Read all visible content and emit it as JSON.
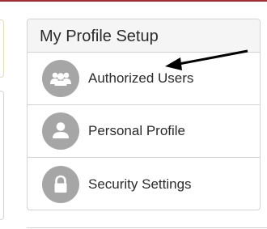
{
  "colors": {
    "top_rule": "#a32b38",
    "icon_circle": "#a6a6a6",
    "icon_glyph": "#ffffff",
    "annotation_arrow": "#000000"
  },
  "profile_panel": {
    "title": "My Profile Setup",
    "items": [
      {
        "label": "Authorized Users",
        "icon": "users-group-icon"
      },
      {
        "label": "Personal Profile",
        "icon": "user-icon"
      },
      {
        "label": "Security Settings",
        "icon": "lock-icon"
      }
    ]
  }
}
